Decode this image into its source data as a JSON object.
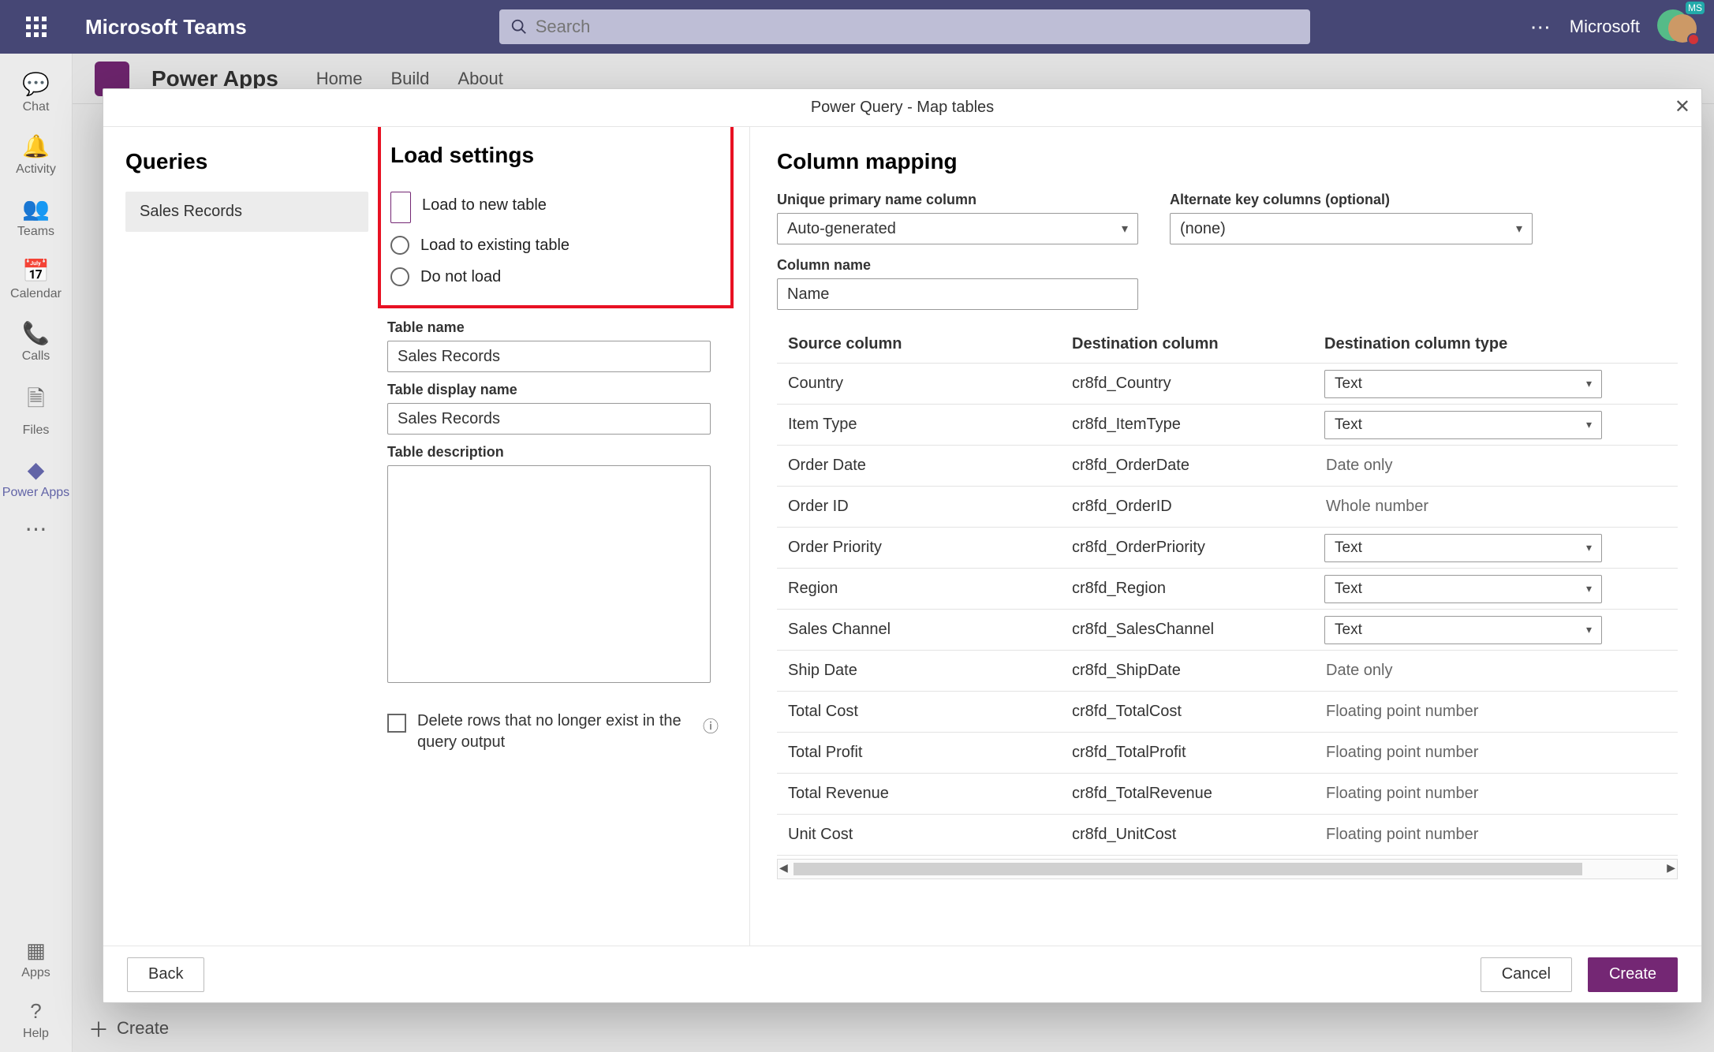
{
  "titlebar": {
    "brand": "Microsoft Teams",
    "search_placeholder": "Search",
    "org_label": "Microsoft",
    "avatar_badge": "MS"
  },
  "rail": {
    "items": [
      {
        "id": "chat",
        "label": "Chat",
        "glyph": "💬"
      },
      {
        "id": "activity",
        "label": "Activity",
        "glyph": "🔔"
      },
      {
        "id": "teams",
        "label": "Teams",
        "glyph": "👥"
      },
      {
        "id": "calendar",
        "label": "Calendar",
        "glyph": "📅"
      },
      {
        "id": "calls",
        "label": "Calls",
        "glyph": "📞"
      },
      {
        "id": "files",
        "label": "Files",
        "glyph": "🗎"
      },
      {
        "id": "powerapps",
        "label": "Power Apps",
        "glyph": "◆"
      }
    ],
    "apps_label": "Apps",
    "apps_glyph": "▦",
    "help_label": "Help",
    "help_glyph": "?"
  },
  "background": {
    "app_title": "Power Apps",
    "tabs": [
      "Home",
      "Build",
      "About"
    ],
    "footer_create": "Create"
  },
  "modal": {
    "title": "Power Query - Map tables",
    "queries_heading": "Queries",
    "query_item": "Sales Records",
    "load_heading": "Load settings",
    "load_options": {
      "new": "Load to new table",
      "existing": "Load to existing table",
      "none": "Do not load"
    },
    "table_name_label": "Table name",
    "table_name_value": "Sales Records",
    "table_display_label": "Table display name",
    "table_display_value": "Sales Records",
    "table_desc_label": "Table description",
    "table_desc_value": "",
    "delete_rows_label": "Delete rows that no longer exist in the query output",
    "mapping_heading": "Column mapping",
    "pk_label": "Unique primary name column",
    "pk_value": "Auto-generated",
    "alt_label": "Alternate key columns (optional)",
    "alt_value": "(none)",
    "colname_label": "Column name",
    "colname_value": "Name",
    "headers": {
      "src": "Source column",
      "dst": "Destination column",
      "type": "Destination column type"
    },
    "rows": [
      {
        "src": "Country",
        "dst": "cr8fd_Country",
        "type": "Text",
        "editable": true
      },
      {
        "src": "Item Type",
        "dst": "cr8fd_ItemType",
        "type": "Text",
        "editable": true
      },
      {
        "src": "Order Date",
        "dst": "cr8fd_OrderDate",
        "type": "Date only",
        "editable": false
      },
      {
        "src": "Order ID",
        "dst": "cr8fd_OrderID",
        "type": "Whole number",
        "editable": false
      },
      {
        "src": "Order Priority",
        "dst": "cr8fd_OrderPriority",
        "type": "Text",
        "editable": true
      },
      {
        "src": "Region",
        "dst": "cr8fd_Region",
        "type": "Text",
        "editable": true
      },
      {
        "src": "Sales Channel",
        "dst": "cr8fd_SalesChannel",
        "type": "Text",
        "editable": true
      },
      {
        "src": "Ship Date",
        "dst": "cr8fd_ShipDate",
        "type": "Date only",
        "editable": false
      },
      {
        "src": "Total Cost",
        "dst": "cr8fd_TotalCost",
        "type": "Floating point number",
        "editable": false
      },
      {
        "src": "Total Profit",
        "dst": "cr8fd_TotalProfit",
        "type": "Floating point number",
        "editable": false
      },
      {
        "src": "Total Revenue",
        "dst": "cr8fd_TotalRevenue",
        "type": "Floating point number",
        "editable": false
      },
      {
        "src": "Unit Cost",
        "dst": "cr8fd_UnitCost",
        "type": "Floating point number",
        "editable": false
      }
    ],
    "buttons": {
      "back": "Back",
      "cancel": "Cancel",
      "create": "Create"
    }
  }
}
